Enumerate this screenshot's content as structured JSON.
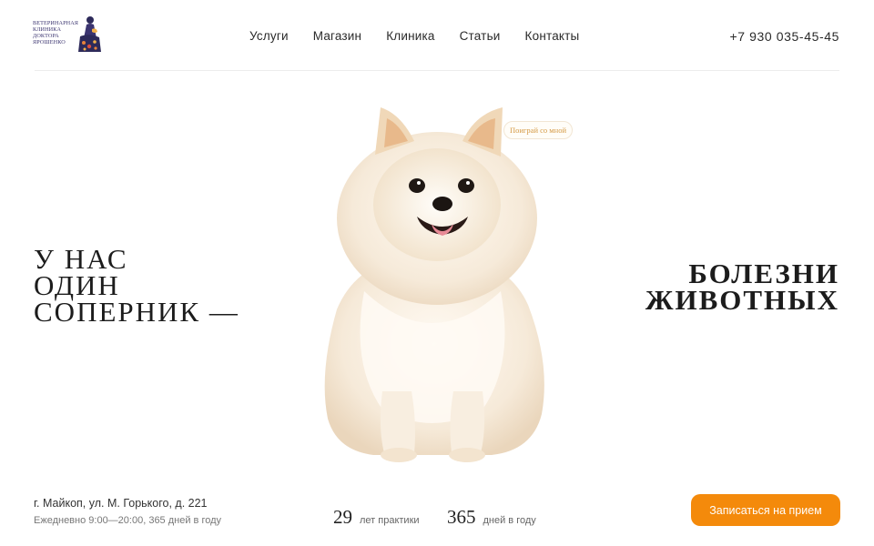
{
  "logo": {
    "lines": [
      "ВЕТЕРИНАРНАЯ",
      "КЛИНИКА",
      "ДОКТОРА",
      "ЯРОШЕНКО"
    ],
    "icon": "woman-with-cat-logo"
  },
  "nav": {
    "items": [
      "Услуги",
      "Магазин",
      "Клиника",
      "Статьи",
      "Контакты"
    ]
  },
  "phone": "+7 930 035-45-45",
  "headline": {
    "left": [
      "У НАС",
      "ОДИН",
      "СОПЕРНИК —"
    ],
    "right": [
      "БОЛЕЗНИ",
      "ЖИВОТНЫХ"
    ]
  },
  "hero": {
    "image": "pomeranian-dog",
    "tag": "Поиграй со мной"
  },
  "footer": {
    "address": "г. Майкоп, ул. М. Горького, д. 221",
    "hours": "Ежедневно 9:00—20:00, 365 дней в году",
    "stats": [
      {
        "value": "29",
        "label": "лет практики"
      },
      {
        "value": "365",
        "label": "дней в году"
      }
    ],
    "cta": "Записаться на прием"
  },
  "colors": {
    "accent": "#f48a0b",
    "logo": "#3b3470",
    "tag_text": "#d59a45"
  }
}
